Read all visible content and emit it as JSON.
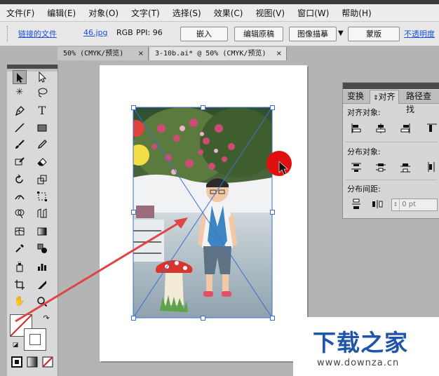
{
  "menu": {
    "items": [
      "文件(F)",
      "编辑(E)",
      "对象(O)",
      "文字(T)",
      "选择(S)",
      "效果(C)",
      "视图(V)",
      "窗口(W)",
      "帮助(H)"
    ]
  },
  "control_bar": {
    "linked_file_label": "链接的文件",
    "filename": "46.jpg",
    "color_mode": "RGB",
    "ppi_label": "PPI: 96",
    "embed_button": "嵌入",
    "edit_original_button": "编辑原稿",
    "image_trace_button": "图像描摹",
    "mask_button": "蒙版",
    "opacity_label": "不透明度"
  },
  "document_tabs": [
    {
      "label": "50% (CMYK/预览)",
      "close": "×"
    },
    {
      "label": "3-10b.ai* @ 50% (CMYK/预览)",
      "close": "×"
    }
  ],
  "align_panel": {
    "tabs": [
      "变换",
      "对齐",
      "路径查找"
    ],
    "align_objects_label": "对齐对象:",
    "distribute_objects_label": "分布对象:",
    "distribute_spacing_label": "分布间距:",
    "spacing_value": "0 pt"
  },
  "watermark": {
    "title": "下载之家",
    "url": "www.downza.cn"
  },
  "colors": {
    "link": "#1b4fd6",
    "selection": "#3b6fd8",
    "arrow": "#e04545",
    "cursor_dot": "#e01010"
  }
}
